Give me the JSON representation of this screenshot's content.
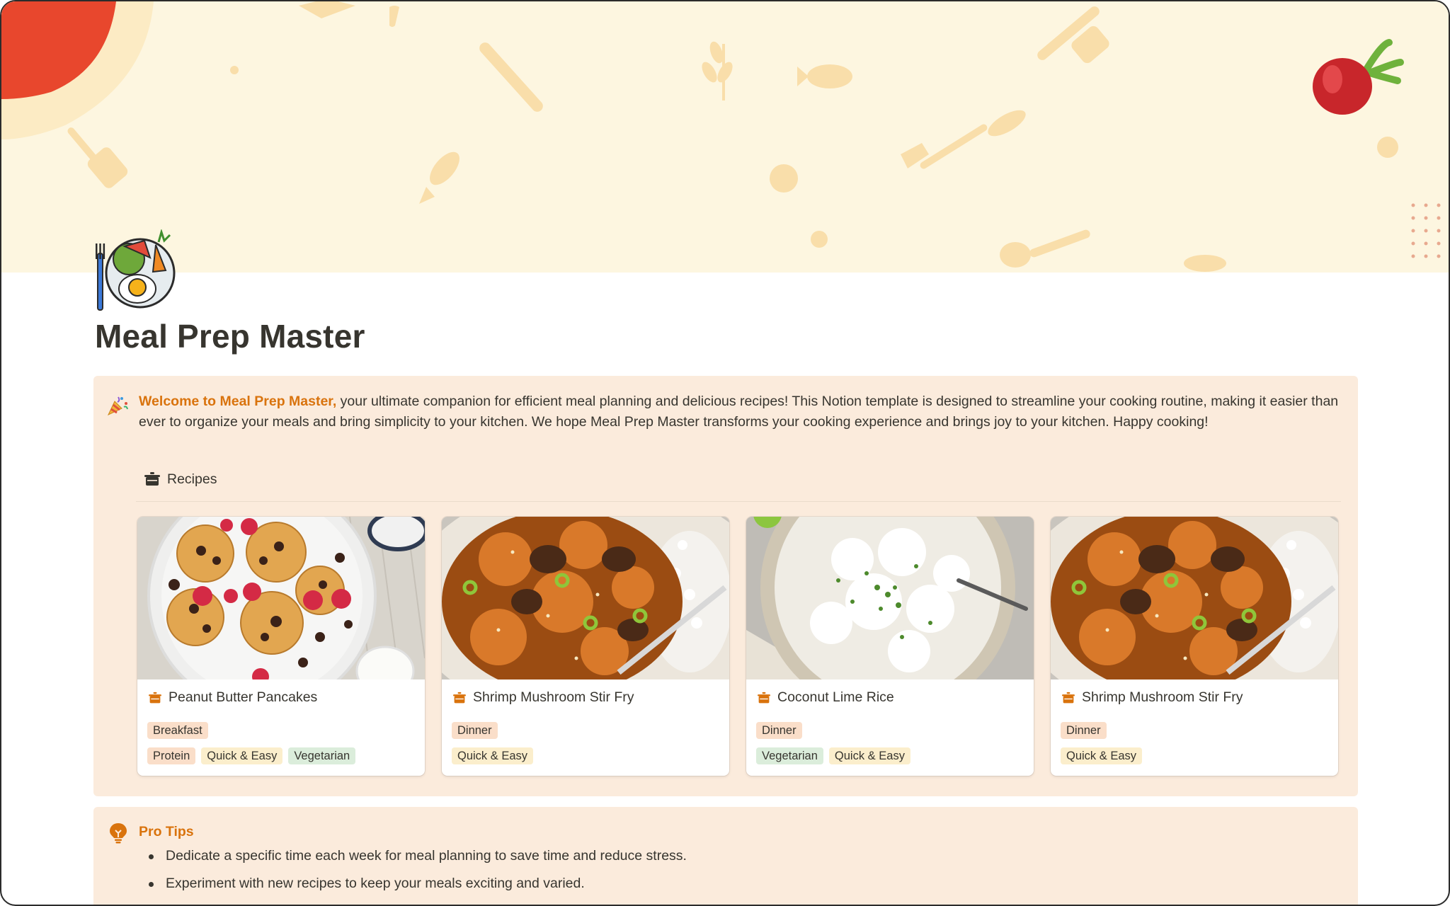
{
  "page": {
    "title": "Meal Prep Master",
    "icon": "meal-plate-icon",
    "cover": "food-pattern-cover"
  },
  "callout": {
    "icon": "party-popper-icon",
    "highlight": "Welcome to Meal Prep Master,",
    "body": " your ultimate companion for efficient meal planning and delicious recipes! This Notion template is designed to streamline your cooking routine, making it easier than ever to organize your meals and bring simplicity to your kitchen. We hope Meal Prep Master transforms your cooking experience and brings joy to your kitchen. Happy cooking!",
    "accent_color": "#d9730d"
  },
  "recipes": {
    "label": "Recipes",
    "icon": "cooking-pot-icon",
    "cards": [
      {
        "title": "Peanut Butter Pancakes",
        "image": "pancakes-photo",
        "tags_row1": [
          "Breakfast"
        ],
        "tags_row2": [
          "Protein",
          "Quick & Easy",
          "Vegetarian"
        ]
      },
      {
        "title": "Shrimp Mushroom Stir Fry",
        "image": "stir-fry-photo",
        "tags_row1": [
          "Dinner"
        ],
        "tags_row2": [
          "Quick & Easy"
        ]
      },
      {
        "title": "Coconut Lime Rice",
        "image": "lime-rice-photo",
        "tags_row1": [
          "Dinner"
        ],
        "tags_row2": [
          "Vegetarian",
          "Quick & Easy"
        ]
      },
      {
        "title": "Shrimp Mushroom Stir Fry",
        "image": "stir-fry-photo",
        "tags_row1": [
          "Dinner"
        ],
        "tags_row2": [
          "Quick & Easy"
        ]
      }
    ]
  },
  "tips": {
    "icon": "lightbulb-icon",
    "title": "Pro Tips",
    "items": [
      "Dedicate a specific time each week for meal planning to save time and reduce stress.",
      "Experiment with new recipes to keep your meals exciting and varied."
    ]
  },
  "colors": {
    "cover_bg": "#fdf6e0",
    "callout_bg": "#fbebdc",
    "tag_orange": "#fadec9",
    "tag_yellow": "#fbeecc",
    "tag_green": "#dbeddb"
  }
}
